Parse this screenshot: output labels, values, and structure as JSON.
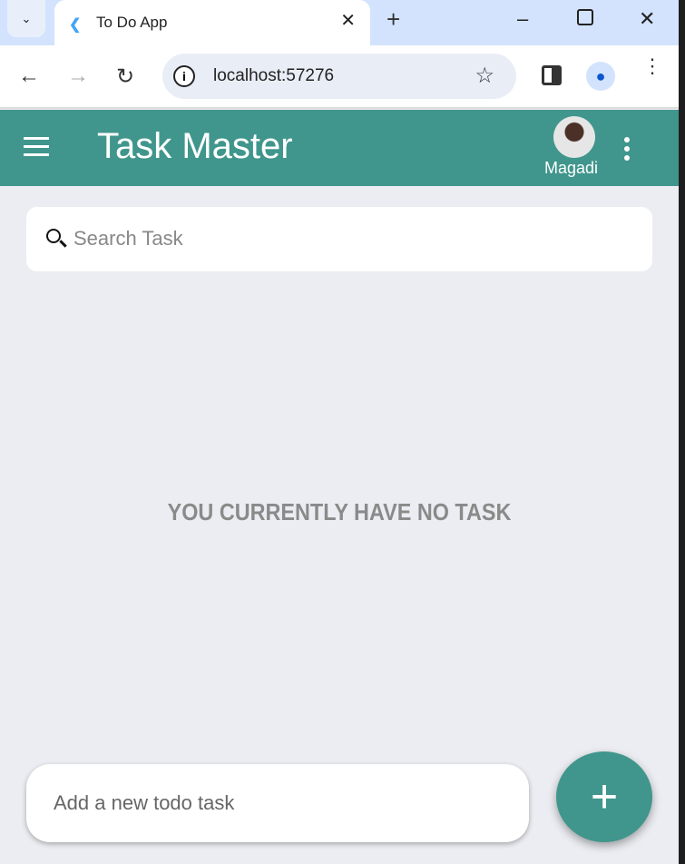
{
  "browser": {
    "tab_title": "To Do App",
    "url": "localhost:57276"
  },
  "app": {
    "title": "Task Master",
    "username": "Magadi",
    "search_placeholder": "Search Task",
    "empty_message": "YOU CURRENTLY HAVE NO TASK",
    "add_placeholder": "Add a new todo task",
    "fab_label": "+"
  },
  "colors": {
    "primary": "#40968c",
    "background": "#ecedf2"
  }
}
